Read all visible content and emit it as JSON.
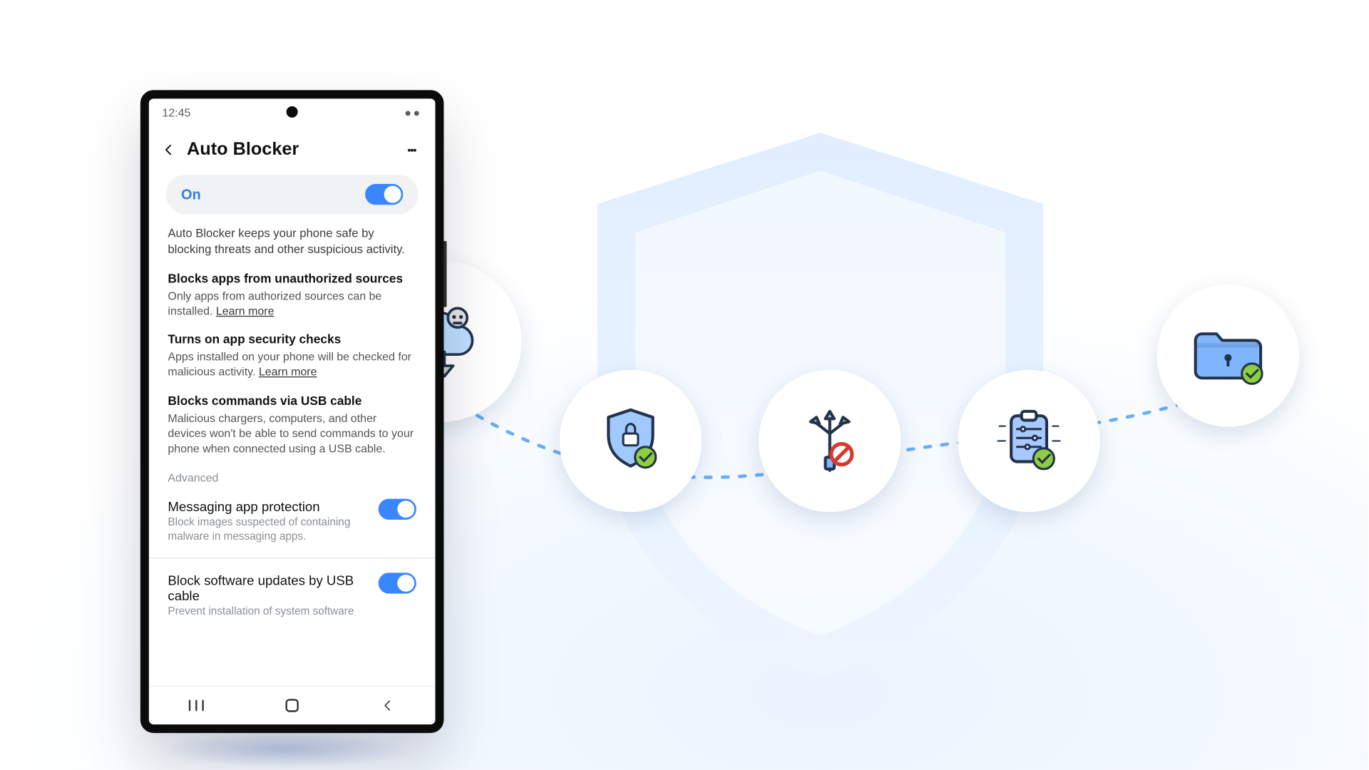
{
  "status": {
    "time": "12:45"
  },
  "header": {
    "title": "Auto Blocker"
  },
  "master": {
    "label": "On"
  },
  "intro": "Auto Blocker keeps your phone safe by blocking threats and other suspicious activity.",
  "sections": [
    {
      "title": "Blocks apps from unauthorized sources",
      "body": "Only apps from authorized sources can be installed.",
      "learn_more": "Learn more"
    },
    {
      "title": "Turns on app security checks",
      "body": "Apps installed on your phone will be checked for malicious activity.",
      "learn_more": "Learn more"
    },
    {
      "title": "Blocks commands via USB cable",
      "body": "Malicious chargers, computers, and other devices won't be able to send commands to your phone when connected using a USB cable."
    }
  ],
  "advanced_label": "Advanced",
  "options": [
    {
      "title": "Messaging app protection",
      "subtitle": "Block images suspected of containing malware in messaging apps."
    },
    {
      "title": "Block software updates by USB cable",
      "subtitle": "Prevent installation of system software"
    }
  ],
  "bubbles": {
    "b1": "malware-cloud-blocked-icon",
    "b2": "shield-lock-check-icon",
    "b3": "usb-trident-blocked-icon",
    "b4": "clipboard-settings-check-icon",
    "b5": "secure-folder-check-icon"
  }
}
